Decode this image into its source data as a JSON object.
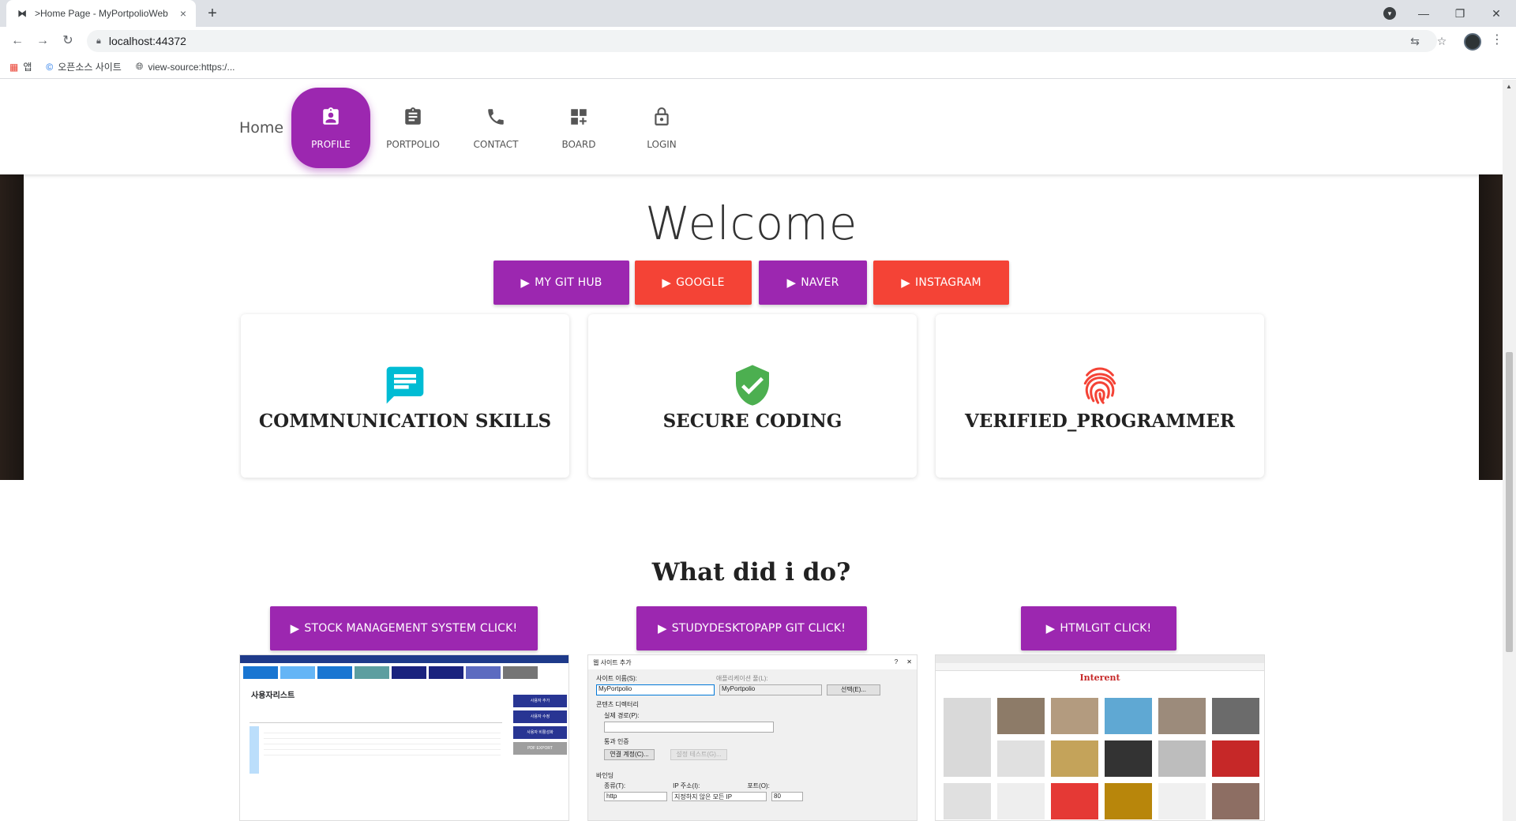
{
  "browser": {
    "tab_title": ">Home Page - MyPortpolioWeb",
    "tab_close": "×",
    "new_tab": "+",
    "url": "localhost:44372",
    "bookmarks": [
      {
        "label": "앱",
        "icon": "apps-grid-icon"
      },
      {
        "label": "오픈소스 사이트",
        "icon": "site-logo-icon"
      },
      {
        "label": "view-source:https:/...",
        "icon": "globe-icon"
      }
    ]
  },
  "nav": {
    "brand": "Home",
    "items": [
      {
        "label": "PROFILE",
        "icon": "profile-badge-icon",
        "active": true
      },
      {
        "label": "PORTPOLIO",
        "icon": "clipboard-icon",
        "active": false
      },
      {
        "label": "CONTACT",
        "icon": "phone-icon",
        "active": false
      },
      {
        "label": "BOARD",
        "icon": "dashboard-add-icon",
        "active": false
      },
      {
        "label": "LOGIN",
        "icon": "lock-icon",
        "active": false
      }
    ]
  },
  "hero": {
    "title": "Welcome",
    "buttons": [
      {
        "label": "MY GIT HUB",
        "color": "#9c27b0"
      },
      {
        "label": "GOOGLE",
        "color": "#f44336"
      },
      {
        "label": "NAVER",
        "color": "#9c27b0"
      },
      {
        "label": "INSTAGRAM",
        "color": "#f44336"
      }
    ]
  },
  "features": [
    {
      "title": "COMMNUNICATION SKILLS",
      "icon": "chat-bubble-icon",
      "color": "#00bcd4"
    },
    {
      "title": "SECURE CODING",
      "icon": "verified-shield-icon",
      "color": "#4caf50"
    },
    {
      "title": "VERIFIED_PROGRAMMER",
      "icon": "fingerprint-icon",
      "color": "#f44336"
    }
  ],
  "projects": {
    "title": "What did i do?",
    "buttons": [
      {
        "label": "STOCK MANAGEMENT SYSTEM CLICK!"
      },
      {
        "label": "STUDYDESKTOPAPP GIT CLICK!"
      },
      {
        "label": "HTMLGIT CLICK!"
      }
    ],
    "screenshots": [
      {
        "heading": "사용자리스트",
        "side_buttons": [
          "사용자 추가",
          "사용자 수정",
          "사용자 비활성화",
          "PDF EXPORT"
        ]
      },
      {
        "dialog_title": "웹 사이트 추가",
        "fields": [
          "사이트 이름(S):",
          "애플리케이션 풀(L):",
          "MyPortpolio",
          "MyPortpolio",
          "선택(E)...",
          "콘텐츠 디렉터리",
          "실제 경로(P):",
          "통과 인증",
          "연결 계정(C)...",
          "설정 테스트(G)...",
          "바인딩",
          "종류(T):",
          "IP 주소(I):",
          "포트(O):",
          "http",
          "지정하지 않은 모든 IP",
          "80"
        ]
      },
      {
        "heading": "Interent"
      }
    ]
  }
}
